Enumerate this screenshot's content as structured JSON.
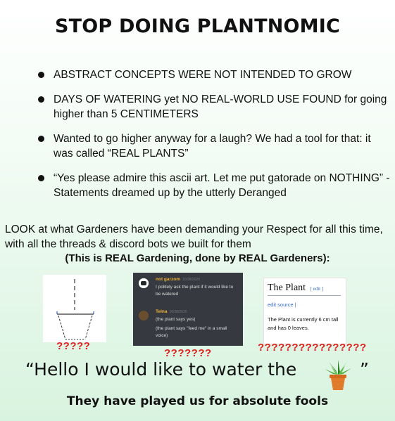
{
  "title": "STOP DOING PLANTNOMIC",
  "bullets": [
    "ABSTRACT CONCEPTS WERE NOT INTENDED TO GROW",
    "DAYS OF WATERING yet NO REAL-WORLD USE FOUND for going higher than 5 CENTIMETERS",
    "Wanted to go higher anyway for a laugh? We had a tool for that: it was called “REAL PLANTS”",
    "“Yes please admire this ascii art. Let me put gatorade on NOTHING” - Statements dreamed up by the utterly Deranged"
  ],
  "look_text": "LOOK at what Gardeners have been demanding your Respect for all this time, with all the threads & discord bots we built for them",
  "subtitle": "(This is REAL Gardening, done by REAL Gardeners):",
  "panels": {
    "ascii": {
      "caption": "?????"
    },
    "discord": {
      "caption": "???????",
      "messages": [
        {
          "user": "not garzom",
          "time": "10/28/2020",
          "lines": [
            "I politely ask the plant if it would like to be watered"
          ],
          "user_color": "#f0b232"
        },
        {
          "user": "Telna",
          "time": "10/28/2020",
          "lines": [
            "(the plant says yes)",
            "(the plant says \"feed me\" in a small voice)"
          ],
          "user_color": "#f0b232"
        }
      ]
    },
    "wiki": {
      "caption": "????????????????",
      "heading": "The Plant",
      "edit_link": "[ edit ]",
      "edit_source": "edit source |",
      "body": "The Plant is currently 6 cm tall and has 0 leaves."
    }
  },
  "quote_text": "“Hello I would like to water the",
  "quote_end": "”",
  "punchline": "They have played us for absolute fools",
  "colors": {
    "question_marks": "#e02020",
    "discord_bg": "#36393f"
  }
}
